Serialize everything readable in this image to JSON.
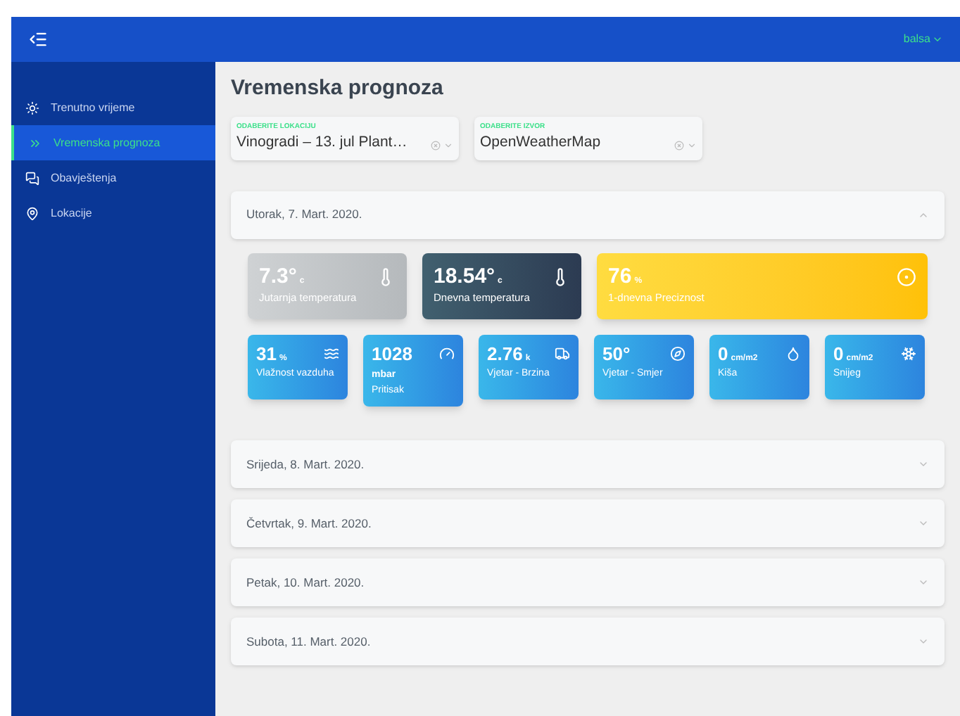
{
  "header": {
    "user": "balsa"
  },
  "sidebar": {
    "items": [
      {
        "label": "Trenutno vrijeme",
        "selected": false
      },
      {
        "label": "Vremenska prognoza",
        "selected": true
      },
      {
        "label": "Obavještenja",
        "selected": false
      },
      {
        "label": "Lokacije",
        "selected": false
      }
    ]
  },
  "page_title": "Vremenska prognoza",
  "selects": [
    {
      "label": "ODABERITE LOKACIJU",
      "value": "Vinogradi – 13. jul Plant…"
    },
    {
      "label": "ODABERITE IZVOR",
      "value": "OpenWeatherMap"
    }
  ],
  "days": [
    {
      "title": "Utorak, 7. Mart. 2020.",
      "expanded": true,
      "cards": [
        {
          "value": "7.3°",
          "unit": "c",
          "label": "Jutarnja temperatura"
        },
        {
          "value": "18.54°",
          "unit": "c",
          "label": "Dnevna temperatura"
        },
        {
          "value": "76",
          "unit": "%",
          "label": "1-dnevna Preciznost"
        },
        {
          "value": "31",
          "unit": "%",
          "label": "Vlažnost vazduha"
        },
        {
          "value": "1028",
          "unit": "mbar",
          "label": "Pritisak"
        },
        {
          "value": "2.76",
          "unit": "k",
          "label": "Vjetar - Brzina"
        },
        {
          "value": "50°",
          "label": "Vjetar - Smjer"
        },
        {
          "value": "0",
          "unit": "cm/m2",
          "label": "Kiša"
        },
        {
          "value": "0",
          "unit": "cm/m2",
          "label": "Snijeg"
        }
      ]
    },
    {
      "title": "Srijeda, 8. Mart. 2020.",
      "expanded": false
    },
    {
      "title": "Četvrtak, 9. Mart. 2020.",
      "expanded": false
    },
    {
      "title": "Petak, 10. Mart. 2020.",
      "expanded": false
    },
    {
      "title": "Subota, 11. Mart. 2020.",
      "expanded": false
    }
  ]
}
